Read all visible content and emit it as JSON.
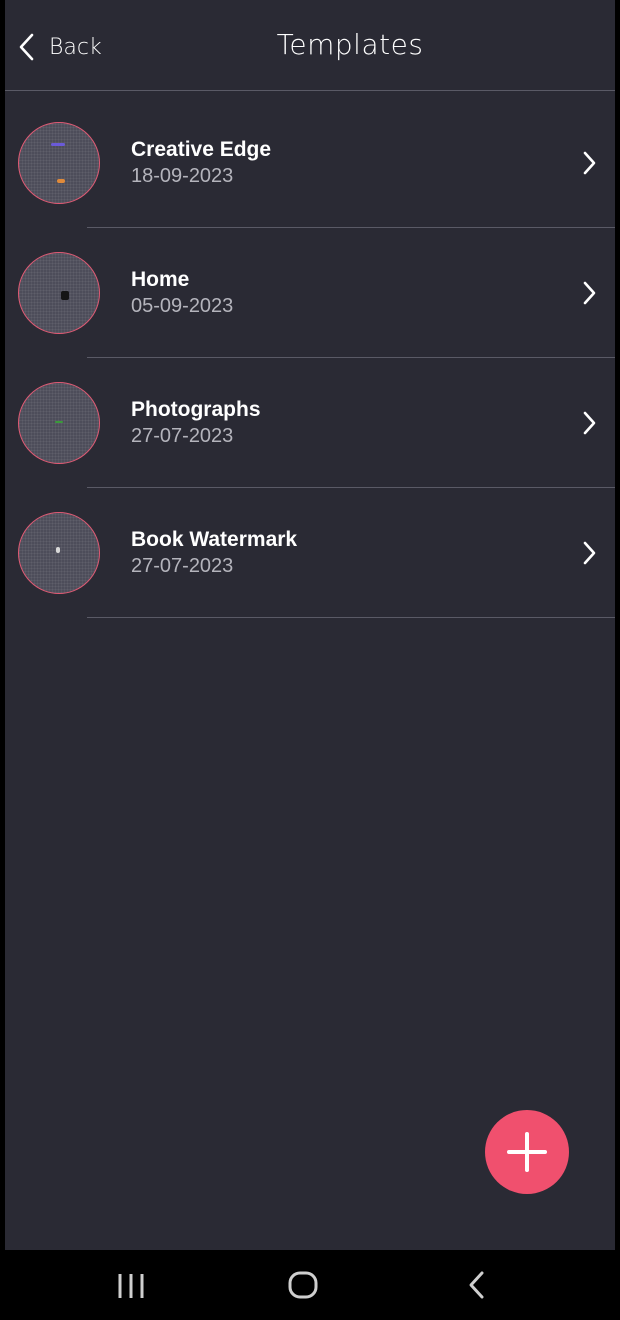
{
  "header": {
    "back_label": "Back",
    "title": "Templates"
  },
  "templates": [
    {
      "name": "Creative Edge",
      "date": "18-09-2023"
    },
    {
      "name": "Home",
      "date": "05-09-2023"
    },
    {
      "name": "Photographs",
      "date": "27-07-2023"
    },
    {
      "name": "Book Watermark",
      "date": "27-07-2023"
    }
  ],
  "icons": {
    "back": "chevron-left-icon",
    "row_arrow": "chevron-right-icon",
    "fab": "plus-icon",
    "nav_recent": "recent-apps-icon",
    "nav_home": "home-icon",
    "nav_back": "back-icon"
  },
  "colors": {
    "background": "#2a2a34",
    "accent": "#f0506e",
    "thumb_border": "#e05a74",
    "text_primary": "#ffffff",
    "text_secondary": "#b4b4bc"
  }
}
